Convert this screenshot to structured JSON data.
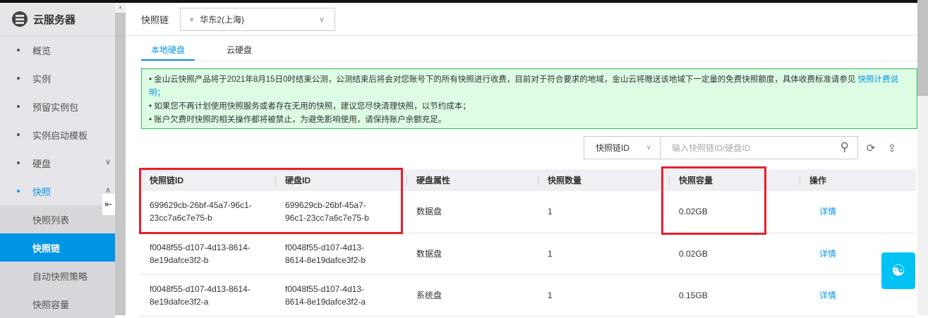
{
  "sidebar": {
    "title": "云服务器",
    "items": [
      {
        "label": "概览"
      },
      {
        "label": "实例"
      },
      {
        "label": "预留实例包"
      },
      {
        "label": "实例启动模板"
      },
      {
        "label": "硬盘"
      },
      {
        "label": "快照"
      }
    ],
    "sub_items": [
      {
        "label": "快照列表"
      },
      {
        "label": "快照链"
      },
      {
        "label": "自动快照策略"
      },
      {
        "label": "快照容量"
      }
    ]
  },
  "header": {
    "label": "快照链",
    "region": "华东2(上海)"
  },
  "tabs": [
    {
      "label": "本地硬盘"
    },
    {
      "label": "云硬盘"
    }
  ],
  "notice": {
    "line1": "金山云快照产品将于2021年8月15日0时结束公测，公测结束后将会对您账号下的所有快照进行收费，目前对于符合要求的地域，金山云将赠送该地域下一定量的免费快照额度，具体收费标准请参见 ",
    "link": "快照计费说明；",
    "line2": "如果您不再计划使用快照服务或者存在无用的快照，建议您尽快清理快照，以节约成本；",
    "line3": "账户欠费时快照的相关操作都将被禁止，为避免影响使用，请保持账户余额充足。"
  },
  "toolbar": {
    "filter": "快照链ID",
    "search_placeholder": "输入快照链ID/硬盘ID"
  },
  "table": {
    "headers": [
      "快照链ID",
      "硬盘ID",
      "硬盘属性",
      "快照数量",
      "快照容量",
      "操作"
    ],
    "rows": [
      {
        "chain_id": "699629cb-26bf-45a7-96c1-23cc7a6c7e75-b",
        "disk_id": "699629cb-26bf-45a7-96c1-23cc7a6c7e75-b",
        "attr": "数据盘",
        "count": "1",
        "capacity": "0.02GB",
        "action": "详情"
      },
      {
        "chain_id": "f0048f55-d107-4d13-8614-8e19dafce3f2-b",
        "disk_id": "f0048f55-d107-4d13-8614-8e19dafce3f2-b",
        "attr": "数据盘",
        "count": "1",
        "capacity": "0.02GB",
        "action": "详情"
      },
      {
        "chain_id": "f0048f55-d107-4d13-8614-8e19dafce3f2-a",
        "disk_id": "f0048f55-d107-4d13-8614-8e19dafce3f2-a",
        "attr": "系统盘",
        "count": "1",
        "capacity": "0.15GB",
        "action": "详情"
      }
    ]
  }
}
